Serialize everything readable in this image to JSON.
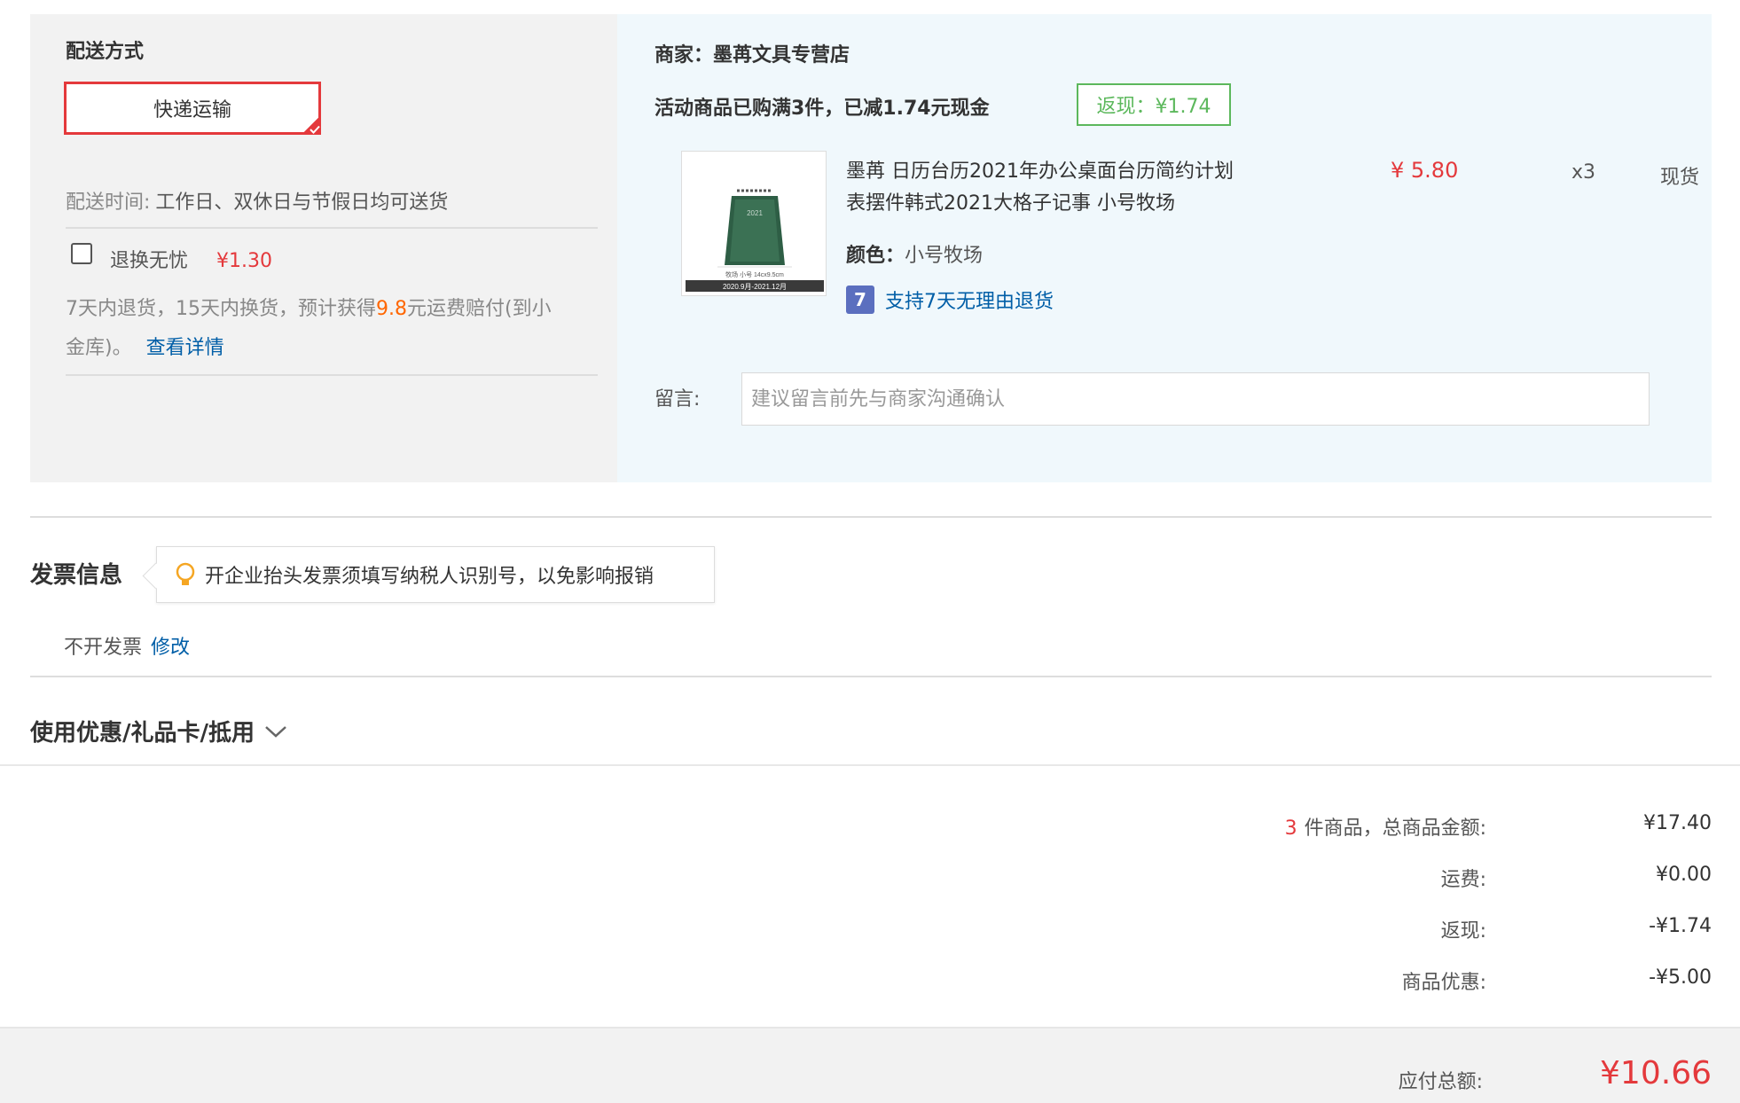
{
  "shipping": {
    "section_title": "配送方式",
    "selected_option": "快递运输",
    "time_label": "配送时间:",
    "time_value": "工作日、双休日与节假日均可送货",
    "return_service_label": "退换无忧",
    "return_service_price": "¥1.30",
    "return_desc_part1": "7天内退货，15天内换货，预计获得",
    "return_desc_amount": "9.8",
    "return_desc_part2": "元运费赔付(到小",
    "return_desc_part3": "金库)。",
    "details_link": "查看详情"
  },
  "merchant": {
    "name_line": "商家：墨苒文具专营店",
    "promo_text": "活动商品已购满3件，已减1.74元现金",
    "cashback_badge": "返现：¥1.74"
  },
  "product": {
    "title_line1": "墨苒 日历台历2021年办公桌面台历简约计划",
    "title_line2": "表摆件韩式2021大格子记事 小号牧场",
    "color_label": "颜色：",
    "color_value": "小号牧场",
    "return_policy": "支持7天无理由退货",
    "return_policy_icon": "7",
    "price": "¥ 5.80",
    "quantity": "x3",
    "stock_status": "现货",
    "image_caption1": "牧场  小号 14cx9.5cm",
    "image_caption2": "2020.9月-2021.12月",
    "image_calendar_text": "2021"
  },
  "message": {
    "label": "留言:",
    "placeholder": "建议留言前先与商家沟通确认"
  },
  "invoice": {
    "title": "发票信息",
    "tip": "开企业抬头发票须填写纳税人识别号，以免影响报销",
    "status": "不开发票",
    "edit_link": "修改"
  },
  "coupons": {
    "title": "使用优惠/礼品卡/抵用"
  },
  "summary": {
    "item_count": "3",
    "item_total_label": "件商品，总商品金额:",
    "item_total_value": "¥17.40",
    "shipping_label": "运费:",
    "shipping_value": "¥0.00",
    "cashback_label": "返现:",
    "cashback_value": "-¥1.74",
    "discount_label": "商品优惠:",
    "discount_value": "-¥5.00",
    "total_label": "应付总额:",
    "total_value": "¥10.66"
  },
  "colors": {
    "accent_red": "#e4393c",
    "link_blue": "#005ea7",
    "cashback_green": "#5cb85c",
    "highlight_orange": "#ff6600"
  }
}
